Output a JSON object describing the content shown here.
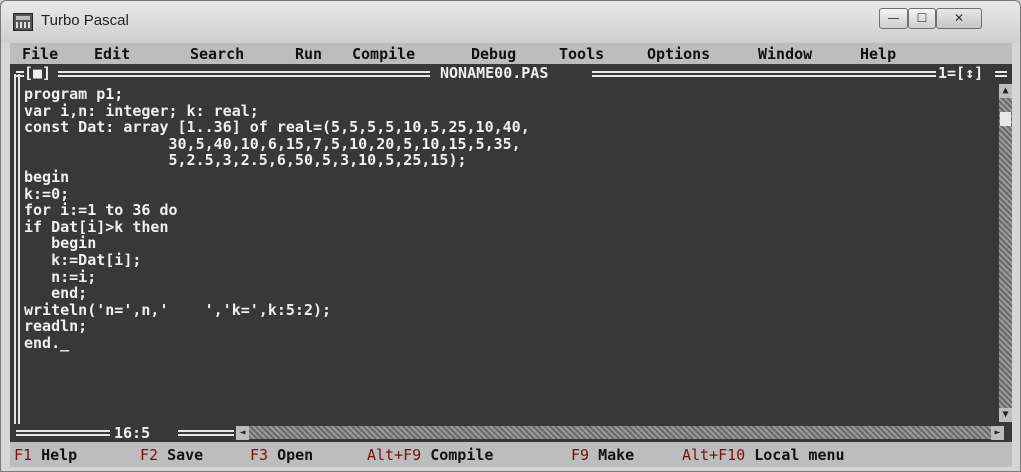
{
  "window": {
    "title": "Turbo Pascal",
    "controls": {
      "minimize": "—",
      "maximize": "☐",
      "close": "✕"
    }
  },
  "menu": {
    "items": [
      "File",
      "Edit",
      "Search",
      "Run",
      "Compile",
      "Debug",
      "Tools",
      "Options",
      "Window",
      "Help"
    ]
  },
  "editor": {
    "window_marker": "[■]",
    "filename": "NONAME00.PAS",
    "window_number": "1=[↕]",
    "code_lines": [
      "program p1;",
      "var i,n: integer; k: real;",
      "const Dat: array [1..36] of real=(5,5,5,5,10,5,25,10,40,",
      "                30,5,40,10,6,15,7,5,10,20,5,10,15,5,35,",
      "                5,2.5,3,2.5,6,50,5,3,10,5,25,15);",
      "begin",
      "k:=0;",
      "for i:=1 to 36 do",
      "if Dat[i]>k then",
      "   begin",
      "   k:=Dat[i];",
      "   n:=i;",
      "   end;",
      "writeln('n=',n,'    ','k=',k:5:2);",
      "readln;",
      "end._"
    ],
    "cursor_position": "16:5"
  },
  "keybar": [
    {
      "key": "F1",
      "label": "Help"
    },
    {
      "key": "F2",
      "label": "Save"
    },
    {
      "key": "F3",
      "label": "Open"
    },
    {
      "key": "Alt+F9",
      "label": "Compile"
    },
    {
      "key": "F9",
      "label": "Make"
    },
    {
      "key": "Alt+F10",
      "label": "Local menu"
    }
  ]
}
